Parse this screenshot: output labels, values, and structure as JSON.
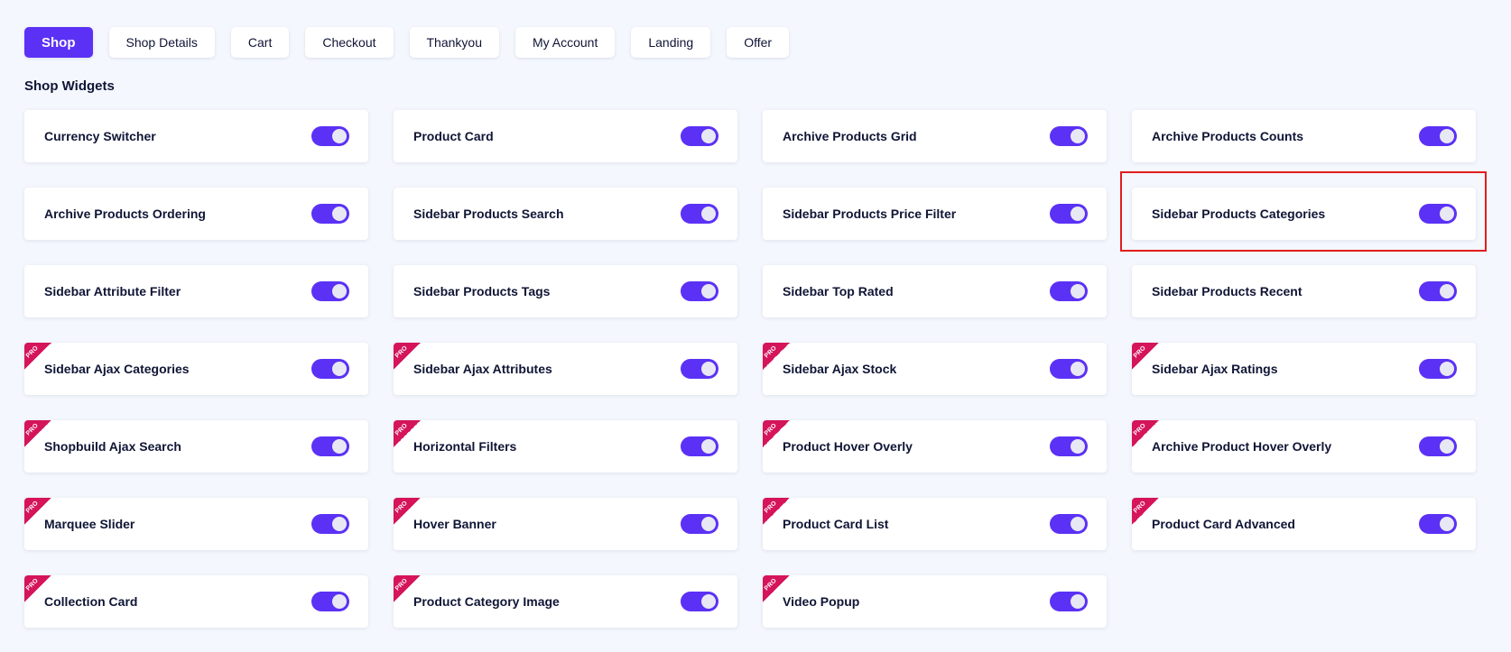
{
  "tabs": [
    {
      "label": "Shop",
      "active": true
    },
    {
      "label": "Shop Details"
    },
    {
      "label": "Cart"
    },
    {
      "label": "Checkout"
    },
    {
      "label": "Thankyou"
    },
    {
      "label": "My Account"
    },
    {
      "label": "Landing"
    },
    {
      "label": "Offer"
    }
  ],
  "section_title": "Shop Widgets",
  "pro_badge": "PRO",
  "colors": {
    "accent": "#5b31f5",
    "pro_ribbon": "#d5145a",
    "highlight_border": "#e01e1e",
    "page_background": "#f4f7fd"
  },
  "widgets": [
    {
      "label": "Currency Switcher",
      "pro": false,
      "enabled": true
    },
    {
      "label": "Product Card",
      "pro": false,
      "enabled": true
    },
    {
      "label": "Archive Products Grid",
      "pro": false,
      "enabled": true
    },
    {
      "label": "Archive Products Counts",
      "pro": false,
      "enabled": true
    },
    {
      "label": "Archive Products Ordering",
      "pro": false,
      "enabled": true
    },
    {
      "label": "Sidebar Products Search",
      "pro": false,
      "enabled": true
    },
    {
      "label": "Sidebar Products Price Filter",
      "pro": false,
      "enabled": true
    },
    {
      "label": "Sidebar Products Categories",
      "pro": false,
      "enabled": true,
      "highlighted": true
    },
    {
      "label": "Sidebar Attribute Filter",
      "pro": false,
      "enabled": true
    },
    {
      "label": "Sidebar Products Tags",
      "pro": false,
      "enabled": true
    },
    {
      "label": "Sidebar Top Rated",
      "pro": false,
      "enabled": true
    },
    {
      "label": "Sidebar Products Recent",
      "pro": false,
      "enabled": true
    },
    {
      "label": "Sidebar Ajax Categories",
      "pro": true,
      "enabled": true
    },
    {
      "label": "Sidebar Ajax Attributes",
      "pro": true,
      "enabled": true
    },
    {
      "label": "Sidebar Ajax Stock",
      "pro": true,
      "enabled": true
    },
    {
      "label": "Sidebar Ajax Ratings",
      "pro": true,
      "enabled": true
    },
    {
      "label": "Shopbuild Ajax Search",
      "pro": true,
      "enabled": true
    },
    {
      "label": "Horizontal Filters",
      "pro": true,
      "enabled": true
    },
    {
      "label": "Product Hover Overly",
      "pro": true,
      "enabled": true
    },
    {
      "label": "Archive Product Hover Overly",
      "pro": true,
      "enabled": true
    },
    {
      "label": "Marquee Slider",
      "pro": true,
      "enabled": true
    },
    {
      "label": "Hover Banner",
      "pro": true,
      "enabled": true
    },
    {
      "label": "Product Card List",
      "pro": true,
      "enabled": true
    },
    {
      "label": "Product Card Advanced",
      "pro": true,
      "enabled": true
    },
    {
      "label": "Collection Card",
      "pro": true,
      "enabled": true
    },
    {
      "label": "Product Category Image",
      "pro": true,
      "enabled": true
    },
    {
      "label": "Video Popup",
      "pro": true,
      "enabled": true
    }
  ]
}
